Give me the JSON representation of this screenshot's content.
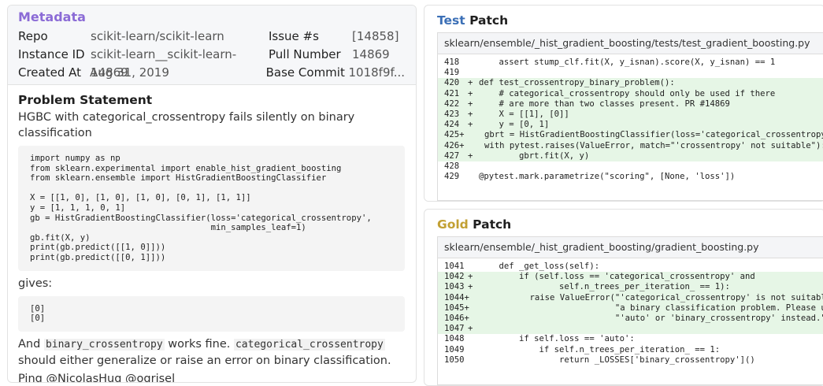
{
  "metadata": {
    "title": "Metadata",
    "repo_label": "Repo",
    "repo": "scikit-learn/scikit-learn",
    "issue_label": "Issue #s",
    "issue": "[14858]",
    "instance_label": "Instance ID",
    "instance": "scikit-learn__scikit-learn-14869",
    "pull_label": "Pull Number",
    "pull": "14869",
    "created_label": "Created At",
    "created": "Aug 31, 2019",
    "commit_label": "Base Commit",
    "commit": "1018f9f..."
  },
  "problem": {
    "title": "Problem Statement",
    "summary": "HGBC with categorical_crossentropy fails silently on binary classification",
    "code_lines": [
      "import numpy as np",
      "from sklearn.experimental import enable_hist_gradient_boosting",
      "from sklearn.ensemble import HistGradientBoostingClassifier",
      "",
      "X = [[1, 0], [1, 0], [1, 0], [0, 1], [1, 1]]",
      "y = [1, 1, 1, 0, 1]",
      "gb = HistGradientBoostingClassifier(loss='categorical_crossentropy',",
      "                                    min_samples_leaf=1)",
      "gb.fit(X, y)",
      "print(gb.predict([[1, 0]]))",
      "print(gb.predict([[0, 1]]))"
    ],
    "gives": "gives:",
    "output_lines": [
      "[0]",
      "[0]"
    ],
    "p1_a": "And ",
    "p1_code1": "binary_crossentropy",
    "p1_b": " works fine. ",
    "p1_code2": "categorical_crossentropy",
    "p1_c": "should either generalize or raise an error on binary classification.",
    "ping": "Ping @NicolasHug @ogrisel"
  },
  "test_patch": {
    "title_colored": "Test",
    "title_rest": " Patch",
    "file": "sklearn/ensemble/_hist_gradient_boosting/tests/test_gradient_boosting.py",
    "lines": [
      {
        "num": "418",
        "sign": "",
        "add": false,
        "code": "    assert stump_clf.fit(X, y_isnan).score(X, y_isnan) == 1"
      },
      {
        "num": "419",
        "sign": "",
        "add": false,
        "code": ""
      },
      {
        "num": "420",
        "sign": "+",
        "add": true,
        "code": "def test_crossentropy_binary_problem():"
      },
      {
        "num": "421",
        "sign": "+",
        "add": true,
        "code": "    # categorical_crossentropy should only be used if there"
      },
      {
        "num": "422",
        "sign": "+",
        "add": true,
        "code": "    # are more than two classes present. PR #14869"
      },
      {
        "num": "423",
        "sign": "+",
        "add": true,
        "code": "    X = [[1], [0]]"
      },
      {
        "num": "424",
        "sign": "+",
        "add": true,
        "code": "    y = [0, 1]"
      },
      {
        "num": "425",
        "sign": "+",
        "add": true,
        "code": "    gbrt = HistGradientBoostingClassifier(loss='categorical_crossentropy')"
      },
      {
        "num": "426",
        "sign": "+",
        "add": true,
        "code": "    with pytest.raises(ValueError, match=\"'crossentropy' not suitable\"):"
      },
      {
        "num": "427",
        "sign": "+",
        "add": true,
        "code": "        gbrt.fit(X, y)"
      },
      {
        "num": "428",
        "sign": "",
        "add": false,
        "code": ""
      },
      {
        "num": "429",
        "sign": "",
        "add": false,
        "code": "@pytest.mark.parametrize(\"scoring\", [None, 'loss'])"
      }
    ]
  },
  "gold_patch": {
    "title_colored": "Gold",
    "title_rest": " Patch",
    "file": "sklearn/ensemble/_hist_gradient_boosting/gradient_boosting.py",
    "lines": [
      {
        "num": "1041",
        "sign": "",
        "add": false,
        "code": "    def _get_loss(self):"
      },
      {
        "num": "1042",
        "sign": "+",
        "add": true,
        "code": "        if (self.loss == 'categorical_crossentropy' and"
      },
      {
        "num": "1043",
        "sign": "+",
        "add": true,
        "code": "                self.n_trees_per_iteration_ == 1):"
      },
      {
        "num": "1044",
        "sign": "+",
        "add": true,
        "code": "            raise ValueError(\"'categorical_crossentropy' is not suitable for \""
      },
      {
        "num": "1045",
        "sign": "+",
        "add": true,
        "code": "                             \"a binary classification problem. Please use \""
      },
      {
        "num": "1046",
        "sign": "+",
        "add": true,
        "code": "                             \"'auto' or 'binary_crossentropy' instead.\")"
      },
      {
        "num": "1047",
        "sign": "+",
        "add": true,
        "code": ""
      },
      {
        "num": "1048",
        "sign": "",
        "add": false,
        "code": "        if self.loss == 'auto':"
      },
      {
        "num": "1049",
        "sign": "",
        "add": false,
        "code": "            if self.n_trees_per_iteration_ == 1:"
      },
      {
        "num": "1050",
        "sign": "",
        "add": false,
        "code": "                return _LOSSES['binary_crossentropy']()"
      }
    ]
  }
}
